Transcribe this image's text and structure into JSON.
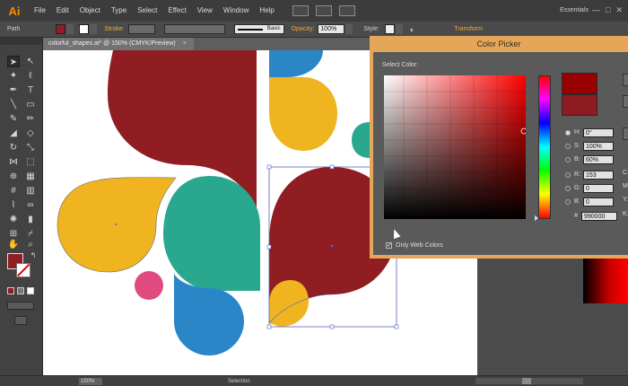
{
  "app": {
    "logo": "Ai"
  },
  "menu": {
    "items": [
      "File",
      "Edit",
      "Object",
      "Type",
      "Select",
      "Effect",
      "View",
      "Window",
      "Help"
    ]
  },
  "workspace": {
    "label": "Essentials"
  },
  "window_controls": {
    "minimize": "—",
    "maximize": "□",
    "close": "✕"
  },
  "control_bar": {
    "object_type": "Path",
    "stroke_label": "Stroke:",
    "brush_label": "Basic",
    "opacity_label": "Opacity:",
    "opacity_value": "100%",
    "style_label": "Style:",
    "transform_label": "Transform"
  },
  "document": {
    "tab_title": "colorful_shapes.ai* @ 150% (CMYK/Preview)",
    "tab_close": "×"
  },
  "colors": {
    "dark_red": "#8f1d21",
    "yellow": "#efb41f",
    "teal": "#2aa88f",
    "blue": "#2a86c7",
    "pink": "#e14a7f",
    "accent_orange": "#f2a53b",
    "picker_frame": "#e6a65a",
    "selection_blue": "#5560c8"
  },
  "tools": {
    "items": [
      "selection-tool",
      "direct-selection-tool",
      "magic-wand-tool",
      "lasso-tool",
      "pen-tool",
      "type-tool",
      "line-segment-tool",
      "rectangle-tool",
      "paintbrush-tool",
      "pencil-tool",
      "blob-brush-tool",
      "eraser-tool",
      "rotate-tool",
      "scale-tool",
      "width-tool",
      "free-transform-tool",
      "shape-builder-tool",
      "perspective-grid-tool",
      "mesh-tool",
      "gradient-tool",
      "eyedropper-tool",
      "blend-tool",
      "symbol-sprayer-tool",
      "column-graph-tool",
      "artboard-tool",
      "slice-tool",
      "hand-tool",
      "zoom-tool"
    ]
  },
  "color_picker": {
    "title": "Color Picker",
    "select_color_label": "Select Color:",
    "only_web_colors_label": "Only Web Colors",
    "only_web_colors_checked": true,
    "new_color": "#990000",
    "fields": {
      "H": {
        "label": "H:",
        "value": "0°"
      },
      "S": {
        "label": "S:",
        "value": "100%"
      },
      "B": {
        "label": "B:",
        "value": "60%"
      },
      "R": {
        "label": "R:",
        "value": "153"
      },
      "G": {
        "label": "G:",
        "value": "0"
      },
      "B2": {
        "label": "B:",
        "value": "0"
      },
      "hex": {
        "label": "#",
        "value": "990000"
      }
    },
    "side_labels": [
      "C:",
      "M:",
      "Y:",
      "K:"
    ]
  },
  "status_bar": {
    "zoom": "150%",
    "tool_status": "Selection"
  }
}
